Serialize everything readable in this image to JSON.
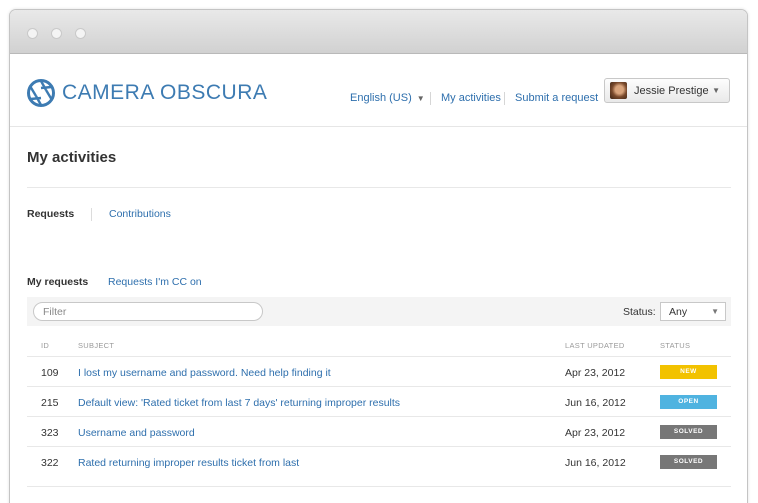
{
  "brand": {
    "name": "CAMERA OBSCURA",
    "logo_icon": "aperture-icon",
    "color": "#3d7bb2"
  },
  "nav": {
    "language": "English (US)",
    "my_activities": "My activities",
    "submit_request": "Submit a request",
    "user_name": "Jessie Prestige"
  },
  "page": {
    "title": "My activities"
  },
  "tabs": {
    "requests": "Requests",
    "contributions": "Contributions"
  },
  "subtabs": {
    "my_requests": "My requests",
    "cc": "Requests I'm CC on"
  },
  "filter": {
    "placeholder": "Filter",
    "status_label": "Status:",
    "status_value": "Any"
  },
  "table": {
    "headers": {
      "id": "ID",
      "subject": "SUBJECT",
      "last_updated": "LAST UPDATED",
      "status": "STATUS"
    },
    "rows": [
      {
        "id": "109",
        "subject": "I lost my username and password. Need help finding it",
        "date": "Apr 23, 2012",
        "status": "NEW",
        "status_color": "#f2c200"
      },
      {
        "id": "215",
        "subject": "Default view: 'Rated ticket from last 7 days' returning improper results",
        "date": "Jun 16, 2012",
        "status": "OPEN",
        "status_color": "#4fb3e0"
      },
      {
        "id": "323",
        "subject": "Username and password",
        "date": "Apr 23, 2012",
        "status": "SOLVED",
        "status_color": "#777777"
      },
      {
        "id": "322",
        "subject": "Rated  returning improper results ticket from last",
        "date": "Jun 16, 2012",
        "status": "SOLVED",
        "status_color": "#777777"
      }
    ]
  }
}
